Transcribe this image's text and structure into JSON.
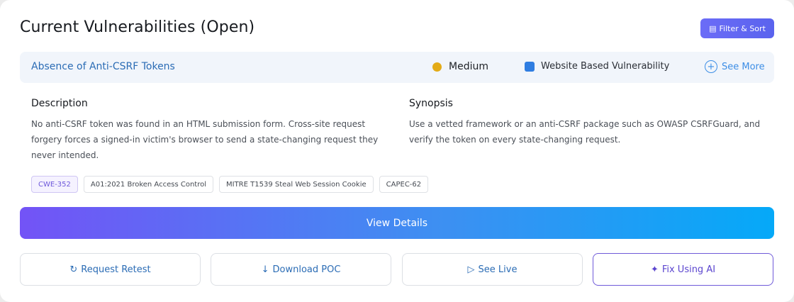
{
  "header": {
    "title": "Current Vulnerabilities (Open)",
    "filter_label": "Filter & Sort",
    "filter_icon": "list-icon"
  },
  "vulnerability": {
    "title": "Absence of Anti-CSRF Tokens",
    "severity": "Medium",
    "severity_color": "#e3ab17",
    "type": "Website Based Vulnerability",
    "type_color": "#2f7de1",
    "see_more_label": "See More",
    "description_heading": "Description",
    "description": "No anti-CSRF token was found in an HTML submission form. Cross-site request forgery forces a signed-in victim's browser to send a state-changing request they never intended.",
    "synopsis_heading": "Synopsis",
    "synopsis": "Use a vetted framework or an anti-CSRF package such as OWASP CSRFGuard, and verify the token on every state-changing request.",
    "tags": [
      "CWE-352",
      "A01:2021 Broken Access Control",
      "MITRE T1539 Steal Web Session Cookie",
      "CAPEC-62"
    ]
  },
  "actions": {
    "view_details_label": "View Details",
    "buttons": [
      {
        "label": "Request Retest",
        "icon": "↻"
      },
      {
        "label": "Download POC",
        "icon": "↓"
      },
      {
        "label": "See Live",
        "icon": "▷"
      },
      {
        "label": "Fix Using AI",
        "icon": "✦"
      }
    ]
  },
  "colors": {
    "accent_blue": "#2b6cb5",
    "accent_purple": "#6f5ad9",
    "gradient_start": "#7353f6",
    "gradient_end": "#05a9f8"
  }
}
